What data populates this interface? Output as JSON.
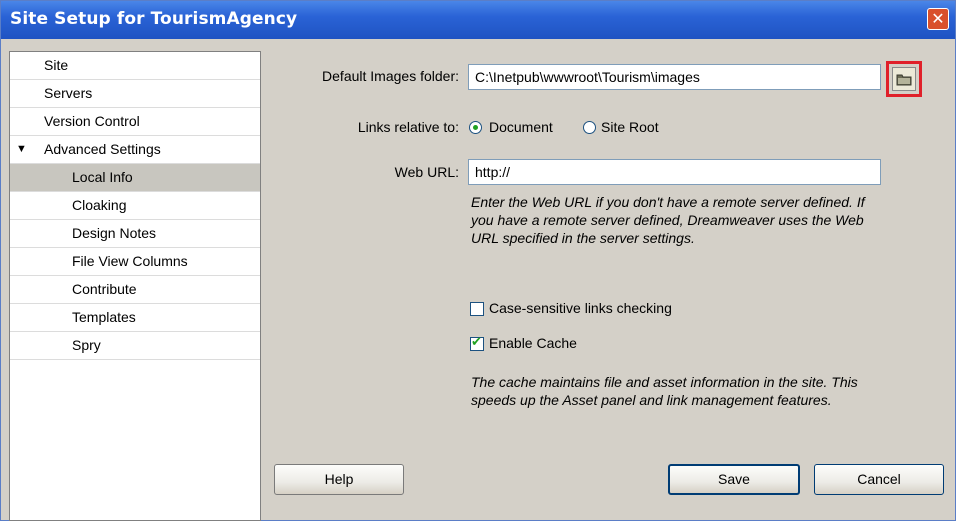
{
  "window": {
    "title": "Site Setup for TourismAgency",
    "close_glyph": "✕"
  },
  "sidebar": {
    "items": [
      {
        "label": "Site",
        "level": 0
      },
      {
        "label": "Servers",
        "level": 0
      },
      {
        "label": "Version Control",
        "level": 0
      },
      {
        "label": "Advanced Settings",
        "level": 0,
        "expanded": true,
        "arrow": "▼"
      },
      {
        "label": "Local Info",
        "level": 1,
        "selected": true
      },
      {
        "label": "Cloaking",
        "level": 1
      },
      {
        "label": "Design Notes",
        "level": 1
      },
      {
        "label": "File View Columns",
        "level": 1
      },
      {
        "label": "Contribute",
        "level": 1
      },
      {
        "label": "Templates",
        "level": 1
      },
      {
        "label": "Spry",
        "level": 1
      }
    ]
  },
  "form": {
    "default_images_label": "Default Images folder:",
    "default_images_value": "C:\\Inetpub\\wwwroot\\Tourism\\images",
    "folder_icon": "folder-icon",
    "links_relative_label": "Links relative to:",
    "radio_document_label": "Document",
    "radio_site_root_label": "Site Root",
    "selected_link_mode": "Document",
    "web_url_label": "Web URL:",
    "web_url_value": "http://",
    "web_url_help": [
      "Enter the Web URL if you don't have a remote server defined. If",
      "you have a remote server defined, Dreamweaver uses the Web",
      "URL specified in the server settings."
    ],
    "case_sensitive_label": "Case-sensitive links checking",
    "case_sensitive_checked": false,
    "enable_cache_label": "Enable Cache",
    "enable_cache_checked": true,
    "check_glyph": "✔",
    "cache_help": [
      "The cache maintains file and asset information in the site. This",
      "speeds up the Asset panel and link management features."
    ]
  },
  "buttons": {
    "help": "Help",
    "save": "Save",
    "cancel": "Cancel"
  },
  "colors": {
    "titlebar": "#2a63d6",
    "highlight_border": "#e0202a",
    "selected_item": "#c8c6bf"
  }
}
